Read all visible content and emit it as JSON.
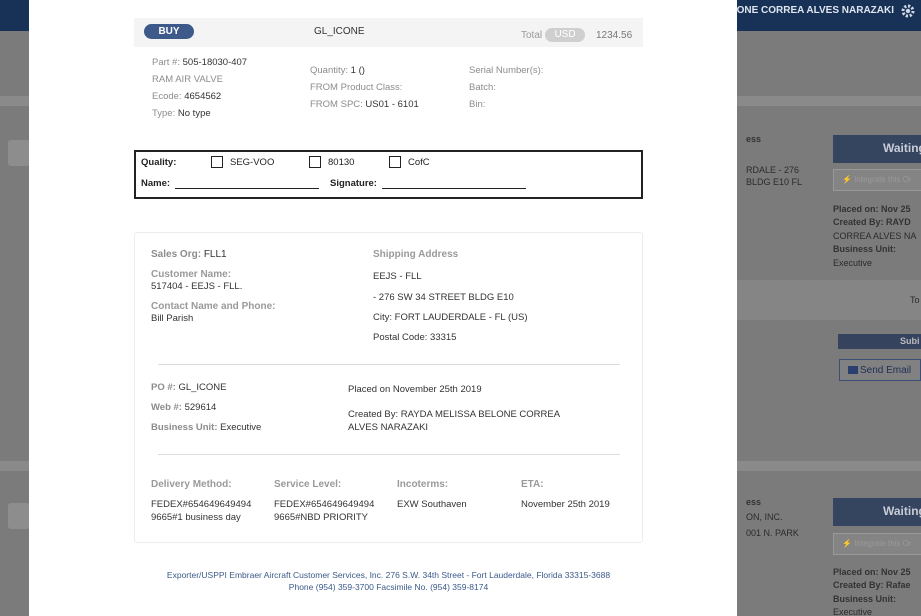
{
  "background": {
    "user_name": "LONE CORREA ALVES NARAZAKI",
    "panel1": {
      "header_fragment": "ess",
      "address_line1": "RDALE - 276",
      "address_line2": "BLDG E10 FL",
      "status_button": "Waiting",
      "integrate_placeholder": "⚡ Integrate this Or",
      "placed_on": "Placed on: Nov 25",
      "created_by_label": "Created By: RAYD",
      "created_by_rest": "CORREA ALVES NA",
      "business_unit_label": "Business Unit:",
      "business_unit_value": "Executive",
      "to_fragment": "To",
      "submit_fragment": "Subi",
      "send_email": "Send Email"
    },
    "panel2": {
      "header_fragment": "ess",
      "address_line1": "ON, INC.",
      "address_line2": "001 N. PARK",
      "status_button": "Waiting",
      "integrate_placeholder": "⚡ Integrate this Or",
      "placed_on": "Placed on: Nov 25",
      "created_by": "Created By: Rafae",
      "business_unit_label": "Business Unit:",
      "business_unit_value": "Executive"
    }
  },
  "modal": {
    "header": {
      "buy_badge": "BUY",
      "code": "GL_ICONE",
      "total_label": "Total",
      "currency": "USD",
      "amount": "1234.56"
    },
    "part": {
      "part_label": "Part #:",
      "part_value": "505-18030-407",
      "description": "RAM AIR VALVE",
      "ecode_label": "Ecode:",
      "ecode_value": "4654562",
      "type_label": "Type:",
      "type_value": "No type",
      "quantity_label": "Quantity:",
      "quantity_value": "1 ()",
      "from_product_class": "FROM Product Class:",
      "from_spc_label": "FROM SPC:",
      "from_spc_value": "US01 - 6101",
      "serial_numbers": "Serial Number(s):",
      "batch": "Batch:",
      "bin": "Bin:"
    },
    "quality": {
      "quality_label": "Quality:",
      "option1": "SEG-VOO",
      "option2": "80130",
      "option3": "CofC",
      "name_label": "Name:",
      "signature_label": "Signature:"
    },
    "order": {
      "sales_org_label": "Sales Org:",
      "sales_org_value": "FLL1",
      "customer_name_label": "Customer Name:",
      "customer_name_value": "517404 - EEJS - FLL.",
      "contact_label": "Contact Name and Phone:",
      "contact_value": "Bill Parish",
      "shipping_label": "Shipping Address",
      "ship_name": "EEJS - FLL",
      "ship_street": "- 276 SW 34 STREET BLDG E10",
      "ship_city": "City: FORT LAUDERDALE - FL (US)",
      "ship_postal": "Postal Code: 33315",
      "po_label": "PO #:",
      "po_value": "GL_ICONE",
      "web_label": "Web #:",
      "web_value": "529614",
      "bu_label": "Business Unit:",
      "bu_value": "Executive",
      "placed_on": "Placed on November 25th 2019",
      "created_by_line1": "Created By: RAYDA MELISSA BELONE CORREA",
      "created_by_line2": "ALVES NARAZAKI",
      "delivery_label": "Delivery Method:",
      "delivery_line1": "FEDEX#654649649494",
      "delivery_line2": "9665#1 business day",
      "service_label": "Service Level:",
      "service_line1": "FEDEX#654649649494",
      "service_line2": "9665#NBD PRIORITY",
      "incoterms_label": "Incoterms:",
      "incoterms_value": "EXW Southaven",
      "eta_label": "ETA:",
      "eta_value": "November 25th 2019"
    },
    "footer": {
      "line1": "Exporter/USPPI Embraer Aircraft Customer Services, Inc. 276 S.W. 34th Street - Fort Lauderdale, Florida 33315-3688",
      "line2": "Phone (954) 359-3700 Facsimile No. (954) 359-8174"
    }
  }
}
